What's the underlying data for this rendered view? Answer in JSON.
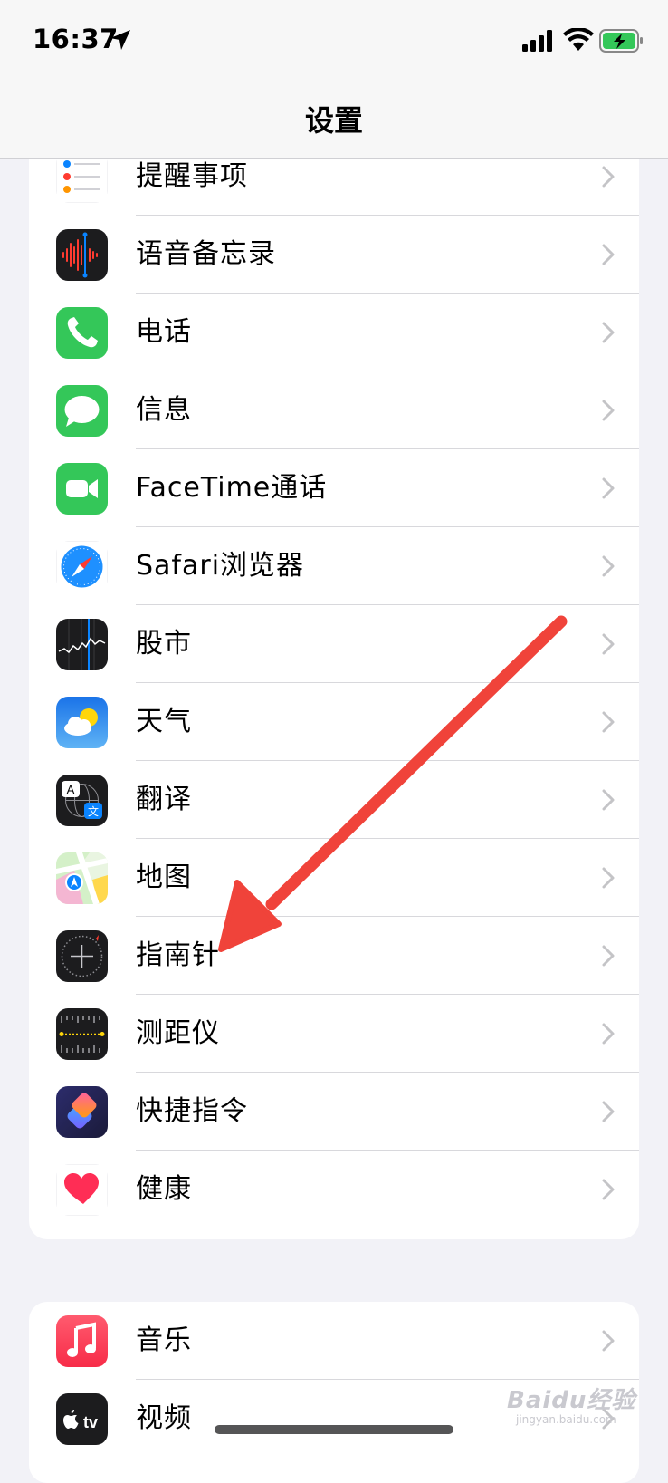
{
  "status_bar": {
    "time": "16:37"
  },
  "nav": {
    "title": "设置"
  },
  "group1": {
    "items": [
      {
        "label": "提醒事项",
        "icon": "reminders-icon"
      },
      {
        "label": "语音备忘录",
        "icon": "voice-memos-icon"
      },
      {
        "label": "电话",
        "icon": "phone-icon"
      },
      {
        "label": "信息",
        "icon": "messages-icon"
      },
      {
        "label": "FaceTime通话",
        "icon": "facetime-icon"
      },
      {
        "label": "Safari浏览器",
        "icon": "safari-icon"
      },
      {
        "label": "股市",
        "icon": "stocks-icon"
      },
      {
        "label": "天气",
        "icon": "weather-icon"
      },
      {
        "label": "翻译",
        "icon": "translate-icon"
      },
      {
        "label": "地图",
        "icon": "maps-icon"
      },
      {
        "label": "指南针",
        "icon": "compass-icon"
      },
      {
        "label": "测距仪",
        "icon": "measure-icon"
      },
      {
        "label": "快捷指令",
        "icon": "shortcuts-icon"
      },
      {
        "label": "健康",
        "icon": "health-icon"
      }
    ]
  },
  "group2": {
    "items": [
      {
        "label": "音乐",
        "icon": "music-icon"
      },
      {
        "label": "视频",
        "icon": "apple-tv-icon"
      }
    ]
  },
  "translate_icon_glyphs": {
    "a": "A",
    "wen": "文"
  },
  "tv_icon_text": "tv",
  "watermark": {
    "text": "Baidu经验",
    "sub": "jingyan.baidu.com"
  },
  "colors": {
    "arrow": "#f0433a",
    "phone": "#34c759",
    "music": "#fa3c55"
  }
}
